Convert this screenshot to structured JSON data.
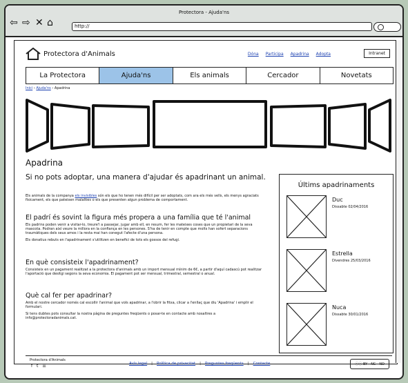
{
  "window": {
    "title": "Protectora - Ajuda'ns",
    "url": "http://"
  },
  "brand": {
    "name": "Protectora d'Animals"
  },
  "top_links": [
    "Dóna",
    "Participa",
    "Apadrina",
    "Adopta"
  ],
  "intranet_label": "Intranet",
  "main_nav": [
    {
      "label": "La Protectora",
      "active": false
    },
    {
      "label": "Ajuda'ns",
      "active": true
    },
    {
      "label": "Els animals",
      "active": false
    },
    {
      "label": "Cercador",
      "active": false
    },
    {
      "label": "Novetats",
      "active": false
    }
  ],
  "breadcrumb": {
    "home": "Inici",
    "parent": "Ajuda'ns",
    "current": "Apadrina"
  },
  "page": {
    "title": "Apadrina",
    "lead": "Si no pots adoptar, una manera d'ajudar és apadrinant un animal.",
    "intro": "Els animals de la companya els invisibles són els que ho tenen més difícil per ser adoptats, com ara els més vells, els menys agraciats físicament, els que pateixen malalties o els que presenten algun problema de comportament.",
    "intro_link": "els invisibles",
    "s1_title": "El padrí és sovint la figura més propera a una família que té l'animal",
    "s1_p1": "Els padrins poden venir a visitar-lo, treure'l a passejar, jugar amb ell, en resum, fer les mateixes coses que un propietari de la seva mascota. Podran així veure la millora en la confiança en les persones. S'ha de tenir en compte que molts han sofert separacions traumàtiques dels seus amos i la resta mai han conegut l'afecte d'una persona.",
    "s1_p2": "Els donatius rebuts en l'apadrinament s'utilitzen en benefici de tots els gossos del refugi.",
    "s2_title": "En què consisteix l'apadrinament?",
    "s2_p": "Consisteix en un pagament realitzat a la protectora d'animals amb un import mensual mínim de 6€, a partir d'aquí cadascú pot realitzar l'aportació que desitgi segons la seva economia. El pagament pot ser mensual, trimestral, semestral o anual.",
    "s3_title": "Què cal fer per apadrinar?",
    "s3_p1": "Amb el nostre cercador només cal escollir l'animal que vols apadrinar, a l'obrir la fitxa, clicar a l'enllaç que diu 'Apadrina' i emplir el formulari.",
    "s3_p2": "Si tens dubtes pots consultar la nostra pàgina de preguntes freqüents o posar-te en contacte amb nosaltres a info@protectoradanimals.cat."
  },
  "sidebar": {
    "title": "Últims apadrinaments",
    "items": [
      {
        "name": "Duc",
        "date": "Dissabte 02/04/2016"
      },
      {
        "name": "Estrella",
        "date": "Divendres 25/03/2016"
      },
      {
        "name": "Nuca",
        "date": "Dissabte 30/01/2016"
      }
    ]
  },
  "footer": {
    "org": "Protectora d'Animals",
    "links": [
      "Avís legal",
      "Política de privacitat",
      "Preguntes freqüents",
      "Contacte"
    ],
    "license": "BY - NC - ND"
  }
}
